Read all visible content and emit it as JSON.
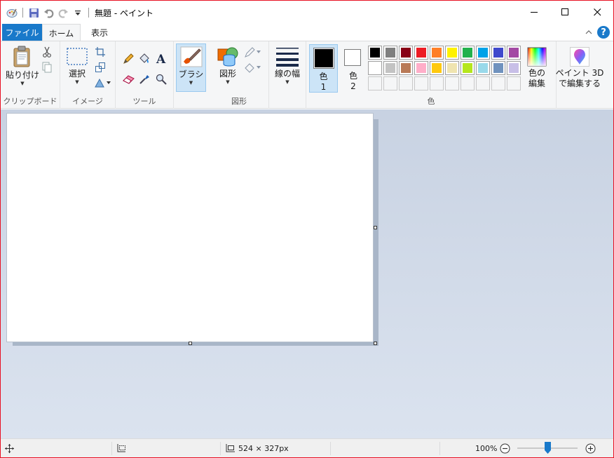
{
  "window": {
    "title": "無題 - ペイント"
  },
  "tabs": {
    "file": "ファイル",
    "home": "ホーム",
    "view": "表示"
  },
  "help": "?",
  "groups": {
    "clipboard": {
      "label": "クリップボード",
      "paste": "貼り付け"
    },
    "image": {
      "label": "イメージ",
      "select": "選択"
    },
    "tools": {
      "label": "ツール"
    },
    "brushes": {
      "label": "ブラシ"
    },
    "shapes": {
      "label": "図形",
      "button": "図形"
    },
    "size": {
      "label": "線の幅"
    },
    "colors": {
      "label": "色",
      "color1": "色",
      "color1_num": "1",
      "color2": "色",
      "color2_num": "2",
      "edit_line1": "色の",
      "edit_line2": "編集",
      "swatches_row1": [
        "#000000",
        "#7f7f7f",
        "#880015",
        "#ed1c24",
        "#ff7f27",
        "#fff200",
        "#22b14c",
        "#00a2e8",
        "#3f48cc",
        "#a349a4"
      ],
      "swatches_row2": [
        "#ffffff",
        "#c3c3c3",
        "#b97a57",
        "#ffaec9",
        "#ffc90e",
        "#efe4b0",
        "#b5e61d",
        "#99d9ea",
        "#7092be",
        "#c8bfe7"
      ]
    },
    "paint3d": {
      "line1": "ペイント 3D",
      "line2": "で編集する"
    }
  },
  "status": {
    "size": "524 × 327px",
    "zoom": "100%",
    "zoom_level_percent": 100
  }
}
